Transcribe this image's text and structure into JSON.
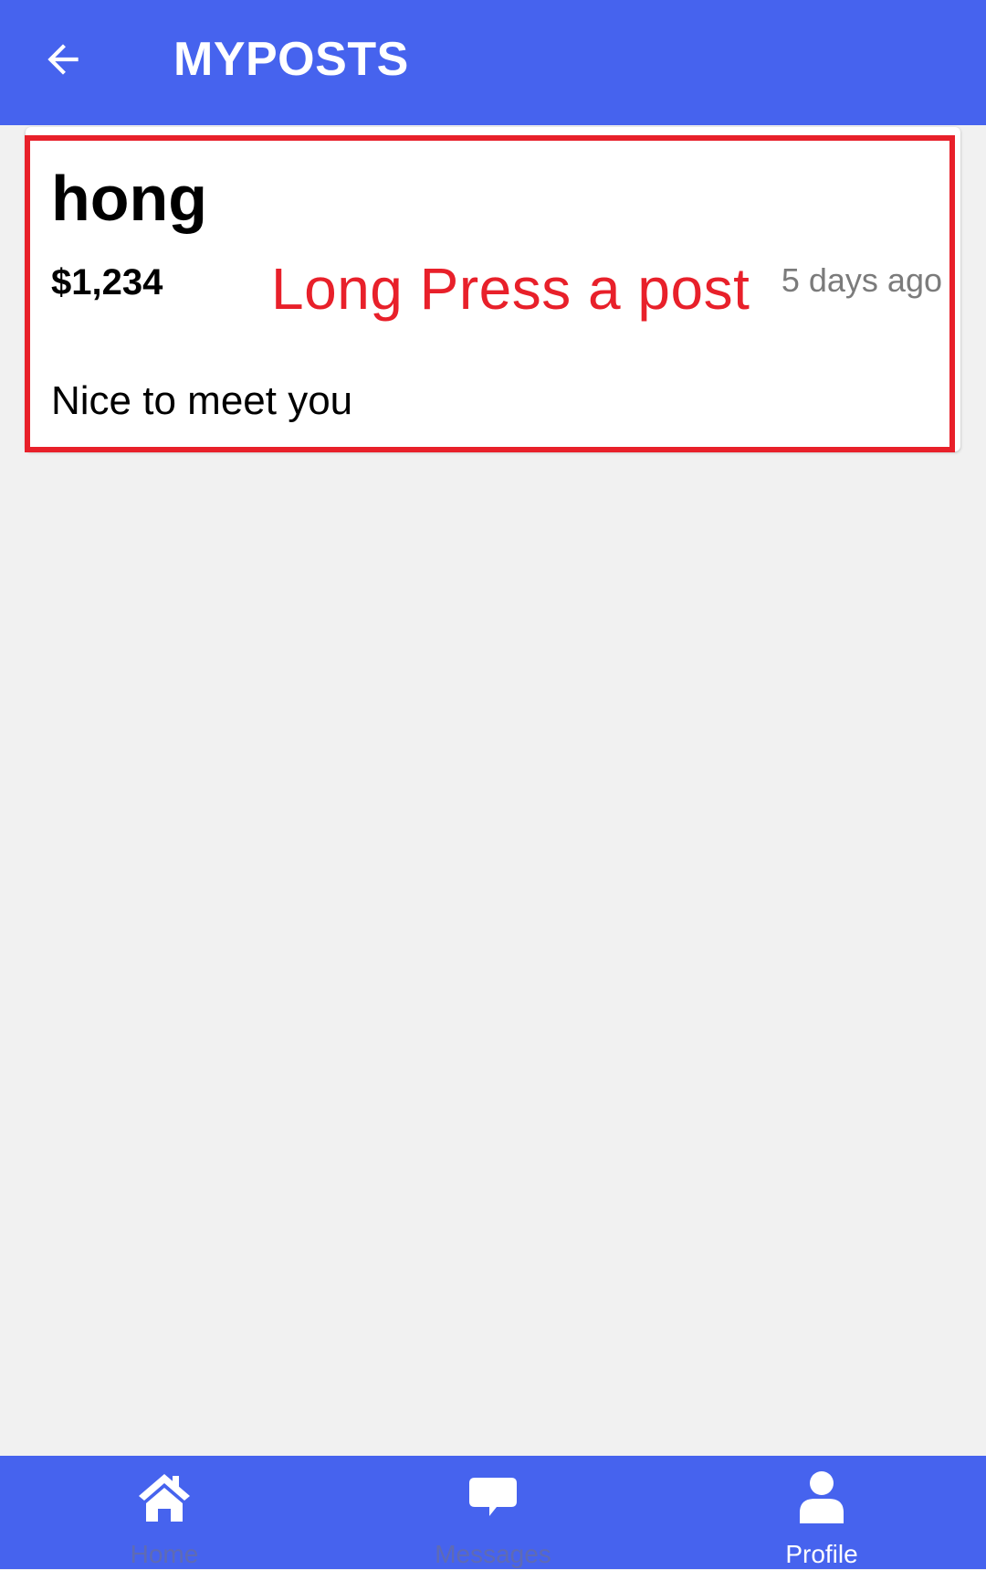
{
  "header": {
    "title": "MYPOSTS",
    "back_icon": "arrow-left-icon"
  },
  "posts": [
    {
      "title": "hong",
      "price": "$1,234",
      "time": "5 days ago",
      "body": "Nice to meet you"
    }
  ],
  "annotation": {
    "text": "Long Press a post",
    "color": "#e8202a"
  },
  "bottom_nav": {
    "items": [
      {
        "label": "Home",
        "icon": "home-icon",
        "active": false
      },
      {
        "label": "Messages",
        "icon": "chat-bubble-icon",
        "active": false
      },
      {
        "label": "Profile",
        "icon": "person-icon",
        "active": true
      }
    ]
  },
  "colors": {
    "primary": "#4663ee",
    "background": "#f1f1f1",
    "card": "#ffffff",
    "muted_text": "#7b7b7b",
    "inactive_nav": "#5f6bb3"
  }
}
